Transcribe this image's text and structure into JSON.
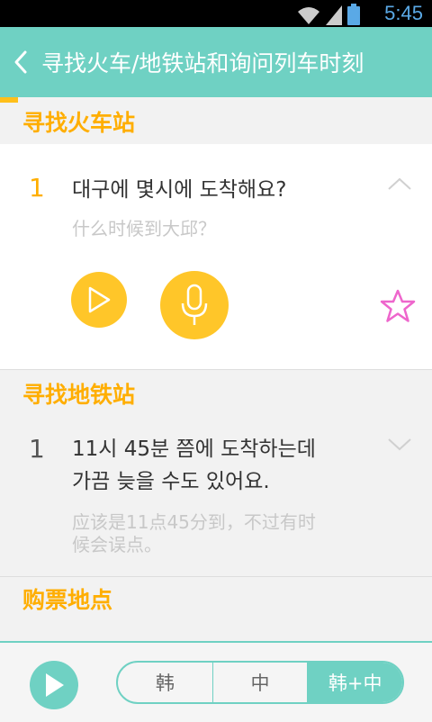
{
  "status_bar": {
    "time": "5:45"
  },
  "app_bar": {
    "title": "寻找火车/地铁站和询问列车时刻"
  },
  "sections": [
    {
      "header": "寻找火车站",
      "item": {
        "number": "1",
        "korean": "대구에 몇시에 도착해요?",
        "chinese": "什么时候到大邱？"
      }
    },
    {
      "header": "寻找地铁站",
      "item": {
        "number": "1",
        "korean_line1": "11시 45분 쯤에 도착하는데",
        "korean_line2": "가끔 늦을 수도 있어요.",
        "chinese_line1": "应该是11点45分到，不过有时",
        "chinese_line2": "候会误点。"
      }
    },
    {
      "header": "购票地点"
    }
  ],
  "footer": {
    "segments": [
      "韩",
      "中",
      "韩+中"
    ],
    "active_segment": "韩+中"
  },
  "colors": {
    "teal": "#6fd1c3",
    "accent": "#ffc629",
    "header_text": "#ffae00",
    "star": "#ee66cc"
  },
  "icons": [
    "back-arrow-icon",
    "chevron-up-icon",
    "chevron-down-icon",
    "play-icon",
    "microphone-icon",
    "star-icon",
    "wifi-icon",
    "signal-icon",
    "battery-icon"
  ]
}
